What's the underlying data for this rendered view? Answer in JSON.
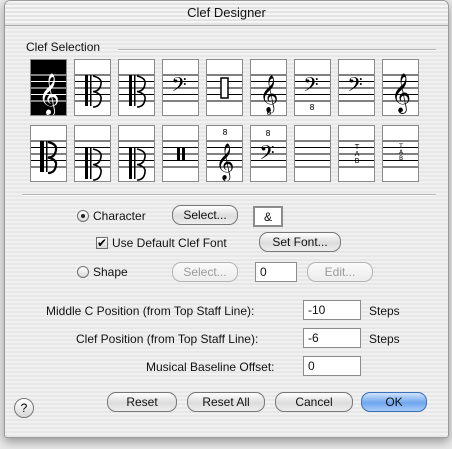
{
  "window": {
    "title": "Clef Designer"
  },
  "clef_selection": {
    "label": "Clef Selection",
    "row1": [
      "treble-clef",
      "alto-clef",
      "alto-clef-narrow",
      "bass-clef",
      "percussion-clef",
      "treble-8vb-clef",
      "bass-8vb-clef",
      "bass-clef-low",
      "treble-clef-high"
    ],
    "row2": [
      "alto-clef-bold",
      "tenor-clef",
      "tenor-clef-narrow",
      "percussion-clef-bars",
      "treble-8va-clef",
      "bass-8va-clef",
      "blank",
      "tab-clef",
      "tab-clef-small"
    ],
    "selected_index": 0
  },
  "character": {
    "radio_label": "Character",
    "select_button": "Select...",
    "glyph": "&",
    "use_default_label": "Use Default Clef Font",
    "set_font_button": "Set Font..."
  },
  "shape": {
    "radio_label": "Shape",
    "select_button": "Select...",
    "value": "0",
    "edit_button": "Edit..."
  },
  "fields": {
    "middle_c_label": "Middle C Position (from Top Staff Line):",
    "middle_c_value": "-10",
    "clef_position_label": "Clef Position (from Top Staff Line):",
    "clef_position_value": "-6",
    "baseline_label": "Musical Baseline Offset:",
    "baseline_value": "0",
    "steps_label": "Steps"
  },
  "buttons": {
    "reset": "Reset",
    "reset_all": "Reset All",
    "cancel": "Cancel",
    "ok": "OK",
    "help": "?"
  }
}
